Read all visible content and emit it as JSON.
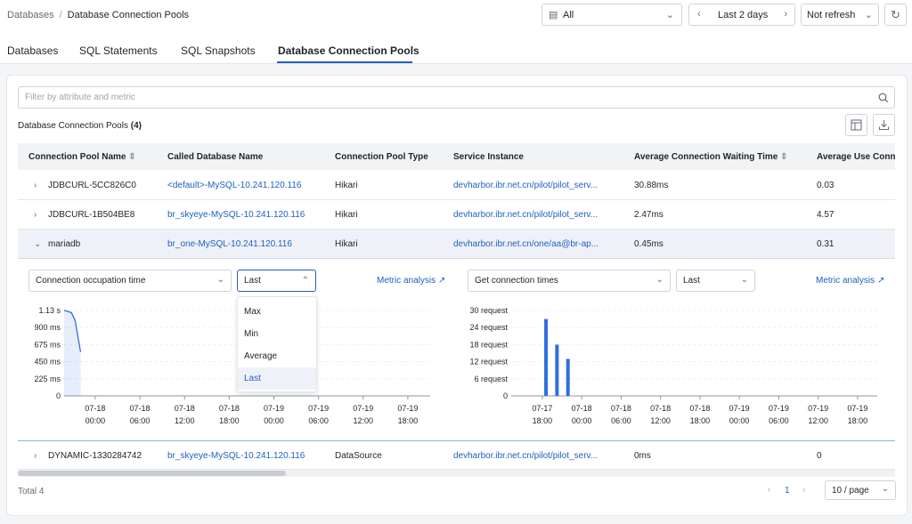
{
  "breadcrumb": {
    "parent": "Databases",
    "separator": "/",
    "current": "Database Connection Pools"
  },
  "toolbar": {
    "db_filter": "All",
    "time_range": "Last 2 days",
    "refresh": "Not refresh"
  },
  "tabs": [
    {
      "label": "Databases"
    },
    {
      "label": "SQL Statements"
    },
    {
      "label": "SQL Snapshots"
    },
    {
      "label": "Database Connection Pools"
    }
  ],
  "filter": {
    "placeholder": "Filter by attribute and metric"
  },
  "section": {
    "title": "Database Connection Pools",
    "count": "(4)"
  },
  "table": {
    "columns": [
      "Connection Pool Name",
      "Called Database Name",
      "Connection Pool Type",
      "Service Instance",
      "Average Connection Waiting Time",
      "Average Use Conn"
    ],
    "rows": [
      {
        "name": "JDBCURL-5CC826C0",
        "db": "<default>-MySQL-10.241.120.116",
        "type": "Hikari",
        "instance": "devharbor.ibr.net.cn/pilot/pilot_serv...",
        "wait": "30.88ms",
        "use": "0.03"
      },
      {
        "name": "JDBCURL-1B504BE8",
        "db": "br_skyeye-MySQL-10.241.120.116",
        "type": "Hikari",
        "instance": "devharbor.ibr.net.cn/pilot/pilot_serv...",
        "wait": "2.47ms",
        "use": "4.57"
      },
      {
        "name": "mariadb",
        "db": "br_one-MySQL-10.241.120.116",
        "type": "Hikari",
        "instance": "devharbor.ibr.net.cn/one/aa@br-ap...",
        "wait": "0.45ms",
        "use": "0.31"
      },
      {
        "name": "DYNAMIC-1330284742",
        "db": "br_skyeye-MySQL-10.241.120.116",
        "type": "DataSource",
        "instance": "devharbor.ibr.net.cn/pilot/pilot_serv...",
        "wait": "0ms",
        "use": "0"
      }
    ]
  },
  "left_panel": {
    "metric": "Connection occupation time",
    "agg": "Last",
    "metric_link": "Metric analysis",
    "dropdown_options": [
      "Max",
      "Min",
      "Average",
      "Last"
    ],
    "selected_option": "Last"
  },
  "right_panel": {
    "metric": "Get connection times",
    "agg": "Last",
    "metric_link": "Metric analysis"
  },
  "chart_data": [
    {
      "type": "line",
      "title": "",
      "ylim": [
        0,
        1.13
      ],
      "yticks": [
        "0",
        "225 ms",
        "450 ms",
        "675 ms",
        "900 ms",
        "1.13 s"
      ],
      "xticks": [
        [
          "07-18",
          "00:00"
        ],
        [
          "07-18",
          "06:00"
        ],
        [
          "07-18",
          "12:00"
        ],
        [
          "07-18",
          "18:00"
        ],
        [
          "07-19",
          "00:00"
        ],
        [
          "07-19",
          "06:00"
        ],
        [
          "07-19",
          "12:00"
        ],
        [
          "07-19",
          "18:00"
        ]
      ],
      "x": [
        0,
        0.01,
        0.02,
        0.03,
        0.045
      ],
      "values": [
        1.13,
        1.12,
        1.1,
        1.0,
        0.58
      ],
      "color": "#2f6fde"
    },
    {
      "type": "bar",
      "title": "",
      "ylim": [
        0,
        30
      ],
      "yticks": [
        "0",
        "6 request",
        "12 request",
        "18 request",
        "24 request",
        "30 request"
      ],
      "xticks": [
        [
          "07-17",
          "18:00"
        ],
        [
          "07-18",
          "00:00"
        ],
        [
          "07-18",
          "06:00"
        ],
        [
          "07-18",
          "12:00"
        ],
        [
          "07-18",
          "18:00"
        ],
        [
          "07-19",
          "00:00"
        ],
        [
          "07-19",
          "06:00"
        ],
        [
          "07-19",
          "12:00"
        ],
        [
          "07-19",
          "18:00"
        ]
      ],
      "x": [
        0.095,
        0.125,
        0.155
      ],
      "values": [
        27,
        18,
        13
      ],
      "color": "#2f6fde"
    }
  ],
  "footer": {
    "total": "Total 4",
    "page": "1",
    "page_size": "10 / page"
  },
  "colors": {
    "accent": "#1f5fbf",
    "chart": "#2f6fde"
  }
}
